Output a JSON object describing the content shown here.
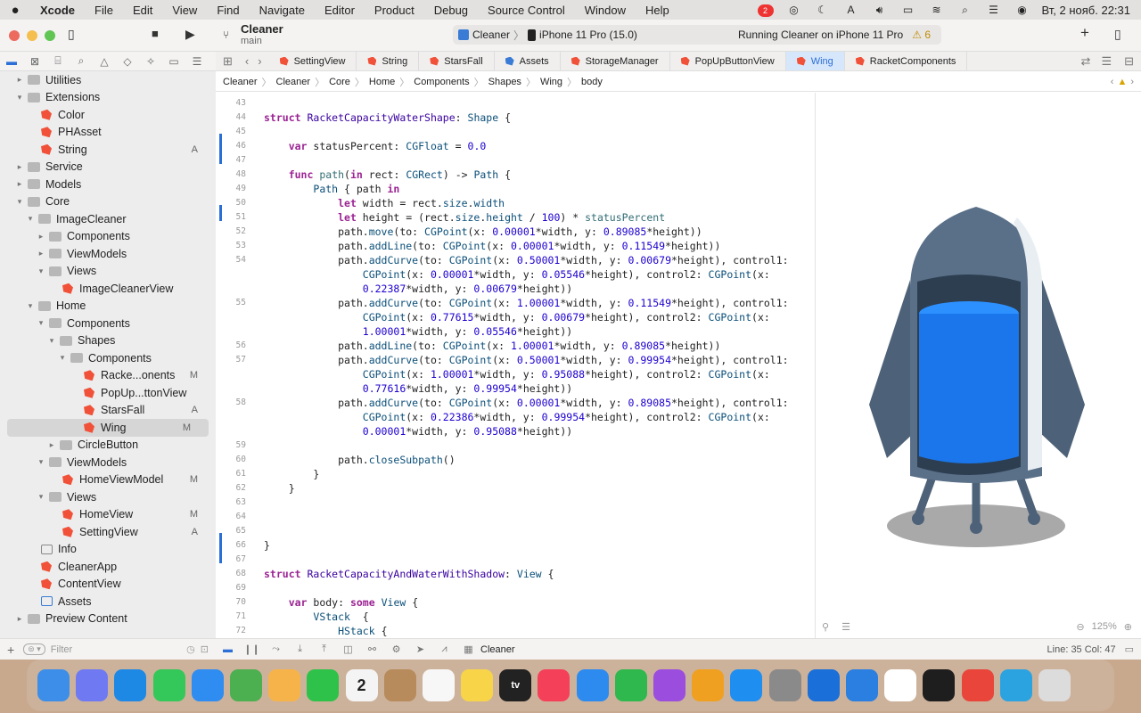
{
  "menubar": {
    "app": "Xcode",
    "items": [
      "File",
      "Edit",
      "View",
      "Find",
      "Navigate",
      "Editor",
      "Product",
      "Debug",
      "Source Control",
      "Window",
      "Help"
    ],
    "notif_count": "2",
    "clock": "Вт, 2 нояб.  22:31"
  },
  "titlebar": {
    "project": "Cleaner",
    "branch": "main",
    "scheme": "Cleaner",
    "device": "iPhone 11 Pro (15.0)",
    "status": "Running Cleaner on iPhone 11 Pro",
    "warnings": "⚠ 6"
  },
  "sidebar": {
    "filter_placeholder": "Filter",
    "items": [
      {
        "label": "Utilities",
        "depth": 1,
        "kind": "group",
        "chev": "▸"
      },
      {
        "label": "Extensions",
        "depth": 1,
        "kind": "group",
        "chev": "▾"
      },
      {
        "label": "Color",
        "depth": 2,
        "kind": "swift",
        "status": ""
      },
      {
        "label": "PHAsset",
        "depth": 2,
        "kind": "swift",
        "status": ""
      },
      {
        "label": "String",
        "depth": 2,
        "kind": "swift",
        "status": "A"
      },
      {
        "label": "Service",
        "depth": 1,
        "kind": "group",
        "chev": "▸"
      },
      {
        "label": "Models",
        "depth": 1,
        "kind": "group",
        "chev": "▸"
      },
      {
        "label": "Core",
        "depth": 1,
        "kind": "group",
        "chev": "▾"
      },
      {
        "label": "ImageCleaner",
        "depth": 2,
        "kind": "group",
        "chev": "▾"
      },
      {
        "label": "Components",
        "depth": 3,
        "kind": "group",
        "chev": "▸"
      },
      {
        "label": "ViewModels",
        "depth": 3,
        "kind": "group",
        "chev": "▸"
      },
      {
        "label": "Views",
        "depth": 3,
        "kind": "group",
        "chev": "▾"
      },
      {
        "label": "ImageCleanerView",
        "depth": 4,
        "kind": "swift",
        "status": ""
      },
      {
        "label": "Home",
        "depth": 2,
        "kind": "group",
        "chev": "▾"
      },
      {
        "label": "Components",
        "depth": 3,
        "kind": "group",
        "chev": "▾"
      },
      {
        "label": "Shapes",
        "depth": 4,
        "kind": "group",
        "chev": "▾"
      },
      {
        "label": "Components",
        "depth": 5,
        "kind": "group",
        "chev": "▾"
      },
      {
        "label": "Racke...onents",
        "depth": 6,
        "kind": "swift",
        "status": "M"
      },
      {
        "label": "PopUp...ttonView",
        "depth": 6,
        "kind": "swift",
        "status": ""
      },
      {
        "label": "StarsFall",
        "depth": 6,
        "kind": "swift",
        "status": "A"
      },
      {
        "label": "Wing",
        "depth": 6,
        "kind": "swift",
        "status": "M",
        "selected": true
      },
      {
        "label": "CircleButton",
        "depth": 4,
        "kind": "group",
        "chev": "▸"
      },
      {
        "label": "ViewModels",
        "depth": 3,
        "kind": "group",
        "chev": "▾"
      },
      {
        "label": "HomeViewModel",
        "depth": 4,
        "kind": "swift",
        "status": "M"
      },
      {
        "label": "Views",
        "depth": 3,
        "kind": "group",
        "chev": "▾"
      },
      {
        "label": "HomeView",
        "depth": 4,
        "kind": "swift",
        "status": "M"
      },
      {
        "label": "SettingView",
        "depth": 4,
        "kind": "swift",
        "status": "A"
      },
      {
        "label": "Info",
        "depth": 2,
        "kind": "grid",
        "status": ""
      },
      {
        "label": "CleanerApp",
        "depth": 2,
        "kind": "swift",
        "status": ""
      },
      {
        "label": "ContentView",
        "depth": 2,
        "kind": "swift",
        "status": ""
      },
      {
        "label": "Assets",
        "depth": 2,
        "kind": "asset",
        "status": ""
      },
      {
        "label": "Preview Content",
        "depth": 1,
        "kind": "group",
        "chev": "▸"
      }
    ]
  },
  "tabs": [
    {
      "label": "SettingView"
    },
    {
      "label": "String"
    },
    {
      "label": "StarsFall"
    },
    {
      "label": "Assets"
    },
    {
      "label": "StorageManager"
    },
    {
      "label": "PopUpButtonView"
    },
    {
      "label": "Wing",
      "active": true
    },
    {
      "label": "RacketComponents"
    }
  ],
  "breadcrumb": [
    "Cleaner",
    "Cleaner",
    "Core",
    "Home",
    "Components",
    "Shapes",
    "Wing",
    "body"
  ],
  "editor": {
    "lines": [
      {
        "n": "43",
        "html": ""
      },
      {
        "n": "44",
        "html": "<span class='kw'>struct</span> <span class='ty'>RacketCapacityWaterShape</span>: <span class='tn'>Shape</span> {"
      },
      {
        "n": "45",
        "html": ""
      },
      {
        "n": "46",
        "html": "    <span class='kw'>var</span> statusPercent: <span class='tn'>CGFloat</span> = <span class='nm'>0.0</span>"
      },
      {
        "n": "47",
        "html": ""
      },
      {
        "n": "48",
        "html": "    <span class='kw'>func</span> <span class='fn'>path</span>(<span class='kw'>in</span> rect: <span class='tn'>CGRect</span>) -> <span class='tn'>Path</span> {"
      },
      {
        "n": "49",
        "html": "        <span class='tn'>Path</span> { path <span class='kw'>in</span>"
      },
      {
        "n": "50",
        "html": "            <span class='kw'>let</span> width = rect.<span class='tn'>size</span>.<span class='tn'>width</span>"
      },
      {
        "n": "51",
        "html": "            <span class='kw'>let</span> height = (rect.<span class='tn'>size</span>.<span class='tn'>height</span> / <span class='nm'>100</span>) * <span class='fn'>statusPercent</span>"
      },
      {
        "n": "52",
        "html": "            path.<span class='tn'>move</span>(to: <span class='tn'>CGPoint</span>(x: <span class='nm'>0.00001</span>*width, y: <span class='nm'>0.89085</span>*height))"
      },
      {
        "n": "53",
        "html": "            path.<span class='tn'>addLine</span>(to: <span class='tn'>CGPoint</span>(x: <span class='nm'>0.00001</span>*width, y: <span class='nm'>0.11549</span>*height))"
      },
      {
        "n": "54",
        "html": "            path.<span class='tn'>addCurve</span>(to: <span class='tn'>CGPoint</span>(x: <span class='nm'>0.50001</span>*width, y: <span class='nm'>0.00679</span>*height), control1:"
      },
      {
        "n": "",
        "html": "                <span class='tn'>CGPoint</span>(x: <span class='nm'>0.00001</span>*width, y: <span class='nm'>0.05546</span>*height), control2: <span class='tn'>CGPoint</span>(x:"
      },
      {
        "n": "",
        "html": "                <span class='nm'>0.22387</span>*width, y: <span class='nm'>0.00679</span>*height))"
      },
      {
        "n": "55",
        "html": "            path.<span class='tn'>addCurve</span>(to: <span class='tn'>CGPoint</span>(x: <span class='nm'>1.00001</span>*width, y: <span class='nm'>0.11549</span>*height), control1:"
      },
      {
        "n": "",
        "html": "                <span class='tn'>CGPoint</span>(x: <span class='nm'>0.77615</span>*width, y: <span class='nm'>0.00679</span>*height), control2: <span class='tn'>CGPoint</span>(x:"
      },
      {
        "n": "",
        "html": "                <span class='nm'>1.00001</span>*width, y: <span class='nm'>0.05546</span>*height))"
      },
      {
        "n": "56",
        "html": "            path.<span class='tn'>addLine</span>(to: <span class='tn'>CGPoint</span>(x: <span class='nm'>1.00001</span>*width, y: <span class='nm'>0.89085</span>*height))"
      },
      {
        "n": "57",
        "html": "            path.<span class='tn'>addCurve</span>(to: <span class='tn'>CGPoint</span>(x: <span class='nm'>0.50001</span>*width, y: <span class='nm'>0.99954</span>*height), control1:"
      },
      {
        "n": "",
        "html": "                <span class='tn'>CGPoint</span>(x: <span class='nm'>1.00001</span>*width, y: <span class='nm'>0.95088</span>*height), control2: <span class='tn'>CGPoint</span>(x:"
      },
      {
        "n": "",
        "html": "                <span class='nm'>0.77616</span>*width, y: <span class='nm'>0.99954</span>*height))"
      },
      {
        "n": "58",
        "html": "            path.<span class='tn'>addCurve</span>(to: <span class='tn'>CGPoint</span>(x: <span class='nm'>0.00001</span>*width, y: <span class='nm'>0.89085</span>*height), control1:"
      },
      {
        "n": "",
        "html": "                <span class='tn'>CGPoint</span>(x: <span class='nm'>0.22386</span>*width, y: <span class='nm'>0.99954</span>*height), control2: <span class='tn'>CGPoint</span>(x:"
      },
      {
        "n": "",
        "html": "                <span class='nm'>0.00001</span>*width, y: <span class='nm'>0.95088</span>*height))"
      },
      {
        "n": "59",
        "html": ""
      },
      {
        "n": "60",
        "html": "            path.<span class='tn'>closeSubpath</span>()"
      },
      {
        "n": "61",
        "html": "        }"
      },
      {
        "n": "62",
        "html": "    }"
      },
      {
        "n": "63",
        "html": ""
      },
      {
        "n": "64",
        "html": ""
      },
      {
        "n": "65",
        "html": ""
      },
      {
        "n": "66",
        "html": "}"
      },
      {
        "n": "67",
        "html": ""
      },
      {
        "n": "68",
        "html": "<span class='kw'>struct</span> <span class='ty'>RacketCapacityAndWaterWithShadow</span>: <span class='tn'>View</span> {"
      },
      {
        "n": "69",
        "html": ""
      },
      {
        "n": "70",
        "html": "    <span class='kw'>var</span> body: <span class='kw'>some</span> <span class='tn'>View</span> {"
      },
      {
        "n": "71",
        "html": "        <span class='tn'>VStack</span>  {"
      },
      {
        "n": "72",
        "html": "            <span class='tn'>HStack</span> {"
      }
    ]
  },
  "canvas": {
    "zoom": "125%"
  },
  "debugbar": {
    "target": "Cleaner",
    "position": "Line: 35  Col: 47"
  },
  "dock": {
    "items": [
      {
        "name": "finder",
        "color": "#3d8ee8"
      },
      {
        "name": "launchpad",
        "color": "#6f7af2"
      },
      {
        "name": "safari",
        "color": "#1e88e5"
      },
      {
        "name": "messages",
        "color": "#34c759"
      },
      {
        "name": "mail",
        "color": "#2f8cf1"
      },
      {
        "name": "maps",
        "color": "#4caf50"
      },
      {
        "name": "photos",
        "color": "#f6b34a"
      },
      {
        "name": "facetime",
        "color": "#2fc24a"
      },
      {
        "name": "calendar",
        "color": "#f4f4f4",
        "text": "2"
      },
      {
        "name": "contacts",
        "color": "#b78b5c"
      },
      {
        "name": "reminders",
        "color": "#f7f7f7"
      },
      {
        "name": "notes",
        "color": "#f8d548"
      },
      {
        "name": "tv",
        "color": "#222222",
        "text": "tv"
      },
      {
        "name": "music",
        "color": "#f5405a"
      },
      {
        "name": "keynote",
        "color": "#2d8bf0"
      },
      {
        "name": "numbers",
        "color": "#2fb84e"
      },
      {
        "name": "podcasts",
        "color": "#9b4dde"
      },
      {
        "name": "pages",
        "color": "#f0a020"
      },
      {
        "name": "appstore",
        "color": "#1f8ef1"
      },
      {
        "name": "system-preferences",
        "color": "#8a8a8a"
      },
      {
        "name": "xcode",
        "color": "#1a6fd8"
      },
      {
        "name": "instruments",
        "color": "#2a7fe0"
      },
      {
        "name": "slack",
        "color": "#ffffff"
      },
      {
        "name": "figma",
        "color": "#1e1e1e"
      },
      {
        "name": "chrome",
        "color": "#e9453b"
      },
      {
        "name": "telegram",
        "color": "#2ba3e0"
      },
      {
        "name": "trash",
        "color": "#dcdcdc"
      }
    ]
  }
}
